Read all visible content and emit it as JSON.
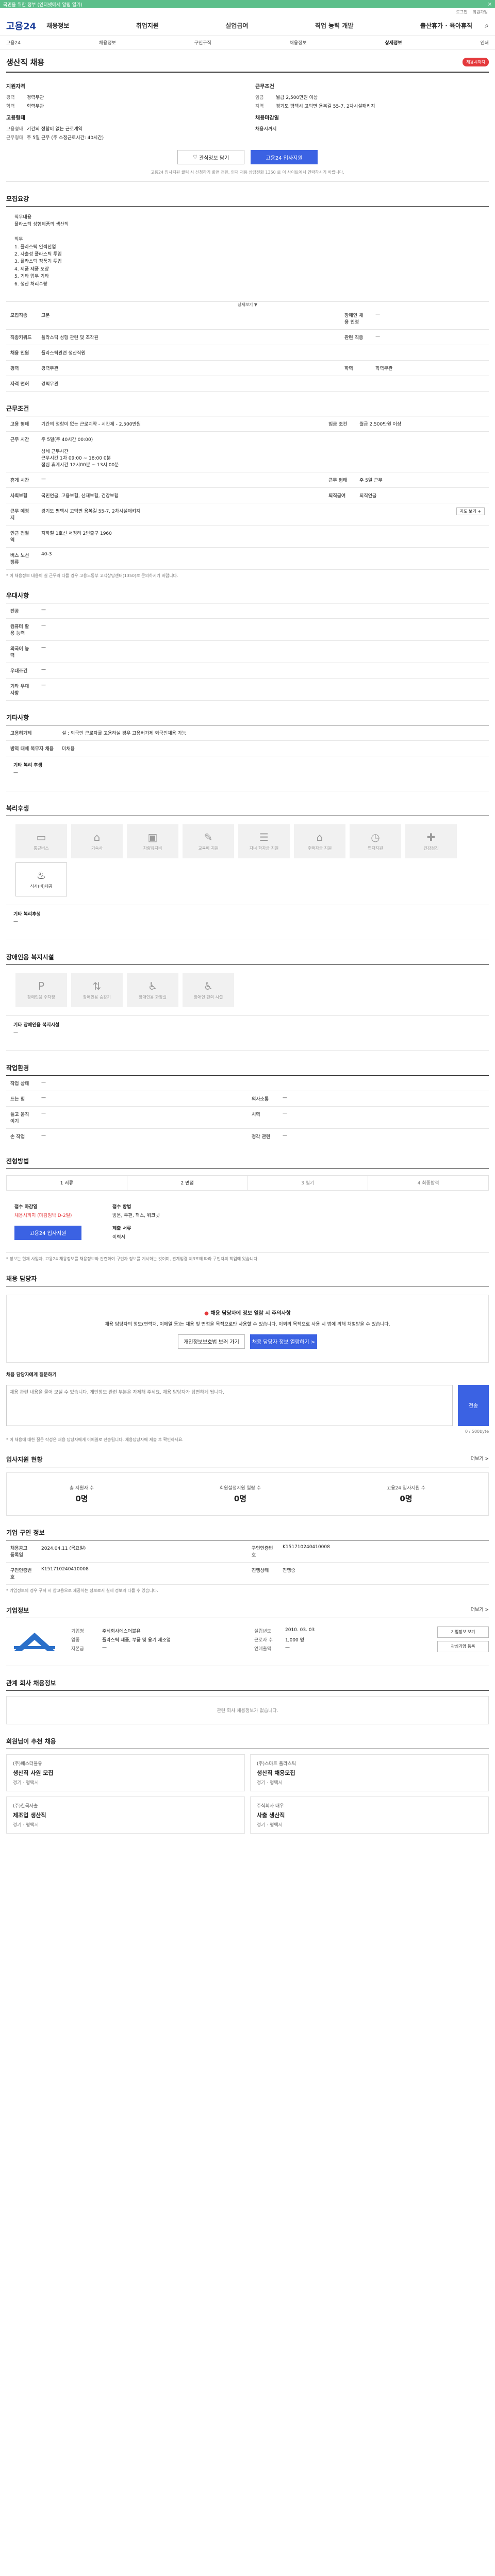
{
  "topbar": {
    "text": "국민을 위한 정부 (인터넷에서 알림 열기)",
    "close": "×"
  },
  "util": [
    "로그인",
    "회원가입"
  ],
  "header": {
    "logo": "고용24",
    "nav": [
      "채용정보",
      "취업지원",
      "실업급여",
      "직업 능력 개발",
      "출산휴가 · 육아휴직"
    ]
  },
  "subnav": [
    "고용24",
    "채용정보",
    "구인구직",
    "채용정보",
    "상세정보",
    "인쇄"
  ],
  "job": {
    "title": "생산직 채용",
    "badge": "채용시까지",
    "applicant_head": "지원자격",
    "applicant": [
      {
        "k": "경력",
        "v": "경력무관"
      },
      {
        "k": "학력",
        "v": "학력무관"
      }
    ],
    "cond_head": "근무조건",
    "cond": [
      {
        "k": "임금",
        "v": "월급 2,500만원 이상"
      },
      {
        "k": "지역",
        "v": "경기도 평택시 고덕면 용복길 55-7, 2차시설패키지"
      }
    ],
    "form_head": "고용형태",
    "form": [
      {
        "k": "고용형태",
        "v": "기간의 정함이 없는 근로계약"
      },
      {
        "k": "근무형태",
        "v": "주 5일 근무 (주 소정근로시간: 40시간)"
      }
    ],
    "deadline_head": "채용마감일",
    "deadline": "채용시까지",
    "btn_save": "관심정보 담기",
    "btn_apply": "고용24 입사지원",
    "note": "고용24 입사지원 클릭 시 신청하기 화면 전환. 인재 채용 상담전화 1350 로 이 사이트에서 연락하시기 바랍니다."
  },
  "recruit": {
    "title": "모집요강",
    "text": "직무내용\n플라스틱 성형제품의 생산직\n\n직무\n1. 플라스틱 인젝션업\n2. 사출성 플라스틱 투입\n3. 플라스틱 정품기 투입\n4. 제품 제품 포장\n5. 기타 업무 기타\n6. 생산 처리수량",
    "more": "상세보기 ▼",
    "rows": [
      [
        {
          "k": "모집직종",
          "v": "고분"
        },
        {
          "k": "장애인 채용 인정",
          "v": "—"
        }
      ],
      [
        {
          "k": "직종키워드",
          "v": "플라스틱 성형 관련 및 조작원"
        },
        {
          "k": "관련 직종",
          "v": "—"
        }
      ],
      [
        {
          "k": "채용 인원",
          "v": "플라스틱관련 생산직원"
        },
        {
          "k": "",
          "v": ""
        }
      ],
      [
        {
          "k": "경력",
          "v": "경력무관"
        },
        {
          "k": "학력",
          "v": "학력무관"
        }
      ],
      [
        {
          "k": "자격 면허",
          "v": "경력무관"
        },
        {
          "k": "",
          "v": ""
        }
      ]
    ]
  },
  "workcond": {
    "title": "근무조건",
    "rows": [
      [
        {
          "k": "고용 형태",
          "v": "기간의 정함이 없는 근로계약 - 시간제 - 2,500만원"
        },
        {
          "k": "임금 조건",
          "v": "월급 2,500만원 이상"
        }
      ],
      [
        {
          "k": "근무 시간",
          "v": "주 5일(주 40시간 00:00)\n\n상세 근무시간\n근무시간 1차 09:00 ~ 18:00 0분\n점심 휴게시간 12시00분 ~ 13시 00분"
        },
        {
          "k": "",
          "v": ""
        }
      ],
      [
        {
          "k": "휴게 시간",
          "v": "—"
        },
        {
          "k": "근무 형태",
          "v": "주 5일 근무"
        }
      ],
      [
        {
          "k": "사회보험",
          "v": "국민연금, 고용보험, 산재보험, 건강보험"
        },
        {
          "k": "퇴직급여",
          "v": "퇴직연금"
        }
      ],
      [
        {
          "k": "근무 예정지",
          "v": "경기도 평택시 고덕면 용복길 55-7, 2차시설패키지"
        },
        {
          "k": "",
          "v": ""
        }
      ],
      [
        {
          "k": "인근 전철역",
          "v": "지하철 1호선 서정리 2번출구 1960"
        },
        {
          "k": "",
          "v": ""
        }
      ],
      [
        {
          "k": "버스 노선 정류",
          "v": "40-3"
        },
        {
          "k": "",
          "v": ""
        }
      ]
    ],
    "note": "* 이 채용정보 내용이 실 근무와 다를 경우 고용노동부 고객상담센터(1350)로 문의하시기 바랍니다.",
    "map_btn": "지도 보기 +"
  },
  "prefer": {
    "title": "우대사항",
    "rows": [
      {
        "k": "전공",
        "v": "—"
      },
      {
        "k": "컴퓨터 활용 능력",
        "v": "—"
      },
      {
        "k": "외국어 능력",
        "v": "—"
      },
      {
        "k": "우대조건",
        "v": "—"
      },
      {
        "k": "기타 우대사항",
        "v": "—"
      }
    ]
  },
  "other": {
    "title": "기타사항",
    "rows": [
      {
        "k": "고용허가제",
        "v": "설 : 외국인 근로자를 고용하실 경우 고용허가제 외국인채용 가능"
      },
      {
        "k": "병역 대체 복무자 채용",
        "v": "미채용"
      }
    ],
    "extra_label": "기타 복리 후생",
    "extra_val": "—"
  },
  "welfare": {
    "title": "복리후생",
    "items": [
      {
        "label": "통근버스",
        "icon": "bus-icon",
        "glyph": "▭",
        "on": false
      },
      {
        "label": "기숙사",
        "icon": "dorm-icon",
        "glyph": "⌂",
        "on": false
      },
      {
        "label": "차량유지비",
        "icon": "car-icon",
        "glyph": "▣",
        "on": false
      },
      {
        "label": "교육비 지원",
        "icon": "edu-icon",
        "glyph": "✎",
        "on": false
      },
      {
        "label": "자녀 학자금 지원",
        "icon": "tuition-icon",
        "glyph": "☰",
        "on": false
      },
      {
        "label": "주택자금 지원",
        "icon": "house-icon",
        "glyph": "⌂",
        "on": false
      },
      {
        "label": "연차지원",
        "icon": "leave-icon",
        "glyph": "◷",
        "on": false
      },
      {
        "label": "건강검진",
        "icon": "health-icon",
        "glyph": "✚",
        "on": false
      },
      {
        "label": "식사(비)제공",
        "icon": "meal-icon",
        "glyph": "♨",
        "on": true
      }
    ],
    "extra_label": "기타 복리후생",
    "extra_val": "—"
  },
  "disabled": {
    "title": "장애인용 복지시설",
    "items": [
      {
        "label": "장애인용 주차장",
        "glyph": "P"
      },
      {
        "label": "장애인용 승강기",
        "glyph": "⇅"
      },
      {
        "label": "장애인용 화장실",
        "glyph": "♿"
      },
      {
        "label": "장애인 편의 시설",
        "glyph": "♿"
      }
    ],
    "extra_label": "기타 장애인용 복지시설",
    "extra_val": "—"
  },
  "env": {
    "title": "작업환경",
    "rows": [
      [
        {
          "k": "작업 상태",
          "v": "—"
        },
        {
          "k": "",
          "v": ""
        }
      ],
      [
        {
          "k": "드는 힘",
          "v": "—"
        },
        {
          "k": "의사소통",
          "v": "—"
        }
      ],
      [
        {
          "k": "들고 움직이기",
          "v": "—"
        },
        {
          "k": "시력",
          "v": "—"
        }
      ],
      [
        {
          "k": "손 작업",
          "v": "—"
        },
        {
          "k": "청각 관련",
          "v": "—"
        }
      ]
    ]
  },
  "process": {
    "title": "전형방법",
    "steps": [
      "1 서류",
      "2 면접",
      "3 필기",
      "4 최종합격"
    ],
    "deadline_label": "접수 마감일",
    "deadline_val": "채용시까지 (마감임박 D-2일)",
    "method_label": "접수 방법",
    "method_val": "방문, 우편, 팩스, 워크넷",
    "doc_label": "제출 서류",
    "doc_val": "이력서",
    "apply_btn": "고용24 입사지원",
    "notes": "* 정보는 현재 사업자, 고용24 채용정보를 채용정보와 관련하여 구인자 정보를 게시하는 것이며, 관계법령 제3조에 따라 구인자의 책임에 있습니다."
  },
  "contact": {
    "title": "채용 담당자",
    "warn_title": "채용 담당자에 정보 열람 시 주의사항",
    "warn_text": "채용 담당자의 정보(연락처, 이메일 등)는 채용 및 면접을 목적으로만 사용할 수 있습니다. 이외의 목적으로 사용 시 법에 의해 처벌받을 수 있습니다.",
    "btn_1": "개인정보보호법 보러 가기",
    "btn_2": "채용 담당자 정보 열람하기 >",
    "qa_label": "채용 담당자에게 질문하기",
    "qa_placeholder": "채용 관련 내용을 물어 보실 수 있습니다. 개인정보 관련 부분은 자제해 주세요. 채용 담당자가 답변하게 됩니다.",
    "qa_counter": "0 / 500byte",
    "qa_btn": "전송",
    "qa_note": "* 이 채용에 대한 질문 작성은 채용 담당자에게 이메일로 전송됩니다. 채용담당자에 제출 후 확인하세요."
  },
  "stats": {
    "title": "입사지원 현황",
    "more": "더보기 >",
    "items": [
      {
        "label": "총 지원자 수",
        "value": "0명"
      },
      {
        "label": "회원설정지원 열람 수",
        "value": "0명"
      },
      {
        "label": "고용24 입사지원 수",
        "value": "0명"
      }
    ]
  },
  "regist": {
    "title": "기업 구인 정보",
    "rows": [
      [
        {
          "k": "채용공고 등록일",
          "v": "2024.04.11 (목요일)"
        },
        {
          "k": "구인인증번호",
          "v": "K151710240410008"
        }
      ],
      [
        {
          "k": "구인인증번호",
          "v": "K151710240410008"
        },
        {
          "k": "진행상태",
          "v": "진행중"
        }
      ]
    ],
    "note": "* 기업정보의 경우 구직 시 참고용으로 제공하는 정보로서 실제 정보와 다를 수 있습니다."
  },
  "company": {
    "title": "기업정보",
    "more": "더보기 >",
    "rows": [
      {
        "k": "기업명",
        "v": "주식회사에스더블유"
      },
      {
        "k": "업종",
        "v": "플라스틱 제품, 부품 및 용기 제조업"
      },
      {
        "k": "설립년도",
        "v": "2010. 03. 03"
      },
      {
        "k": "근로자 수",
        "v": "1,000 명"
      },
      {
        "k": "자본금",
        "v": "—"
      },
      {
        "k": "연매출액",
        "v": "—"
      }
    ],
    "btn_1": "기업정보 보기",
    "btn_2": "관심기업 등록"
  },
  "empty": {
    "title": "관계 회사 채용정보",
    "text": "관련 회사 채용정보가 없습니다."
  },
  "recommend": {
    "title": "회원님이 추천 채용",
    "cards": [
      {
        "company": "(주)에스더블유",
        "title": "생산직 사원 모집",
        "meta": "경기 · 평택시"
      },
      {
        "company": "(주)스마트 플라스틱",
        "title": "생산직 채용모집",
        "meta": "경기 · 평택시"
      },
      {
        "company": "(주)한국사출",
        "title": "제조업 생산직",
        "meta": "경기 · 평택시"
      },
      {
        "company": "주식회사 대우",
        "title": "사출 생산직",
        "meta": "경기 · 평택시"
      }
    ]
  }
}
